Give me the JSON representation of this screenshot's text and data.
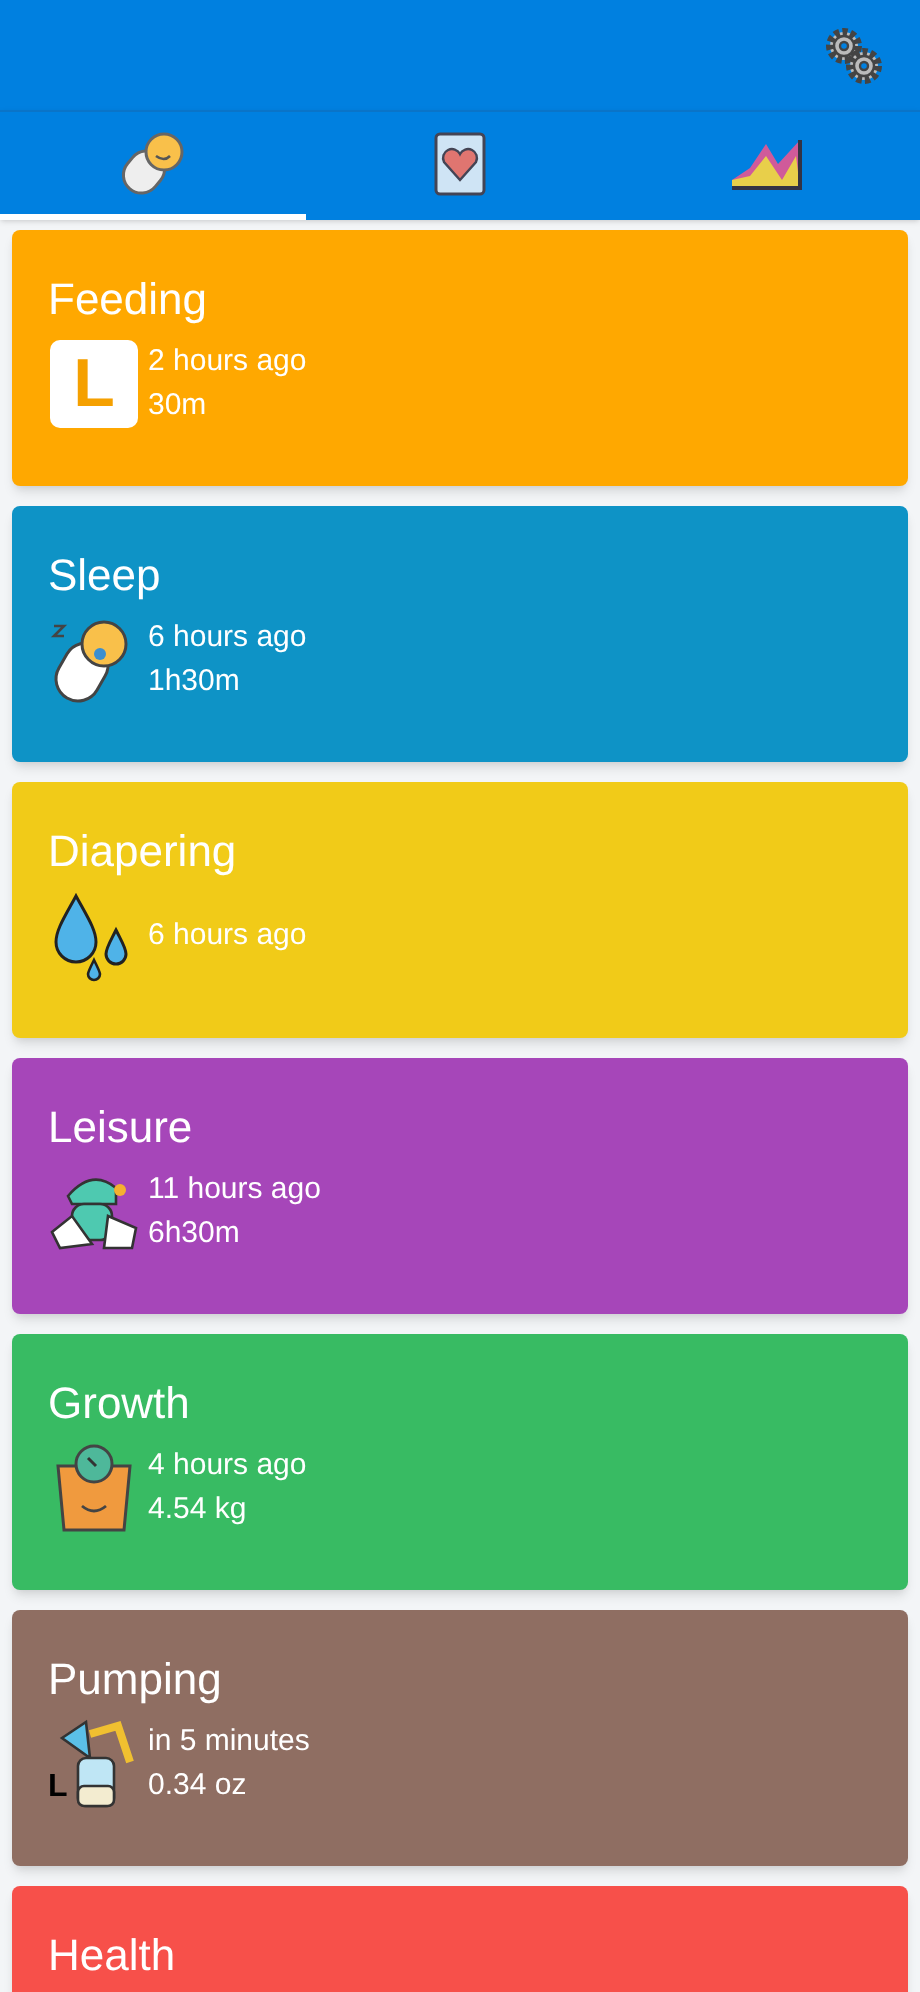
{
  "tabs": [
    {
      "kind": "baby",
      "selected": true
    },
    {
      "kind": "heart",
      "selected": false
    },
    {
      "kind": "chart",
      "selected": false
    }
  ],
  "cards": [
    {
      "kind": "feeding",
      "title": "Feeding",
      "color": "#ffa800",
      "badge": "L",
      "lines": [
        "2 hours ago",
        "30m"
      ]
    },
    {
      "kind": "sleep",
      "title": "Sleep",
      "color": "#0e93c6",
      "lines": [
        "6 hours ago",
        "1h30m"
      ]
    },
    {
      "kind": "diapering",
      "title": "Diapering",
      "color": "#f1cb18",
      "lines": [
        "6 hours ago"
      ]
    },
    {
      "kind": "leisure",
      "title": "Leisure",
      "color": "#a646b9",
      "lines": [
        "11 hours ago",
        "6h30m"
      ]
    },
    {
      "kind": "growth",
      "title": "Growth",
      "color": "#38bb63",
      "lines": [
        "4 hours ago",
        "4.54 kg"
      ]
    },
    {
      "kind": "pumping",
      "title": "Pumping",
      "color": "#8f6e62",
      "badge": "L",
      "lines": [
        "in 5 minutes",
        "0.34 oz"
      ]
    },
    {
      "kind": "health",
      "title": "Health",
      "color": "#f7504a"
    }
  ]
}
